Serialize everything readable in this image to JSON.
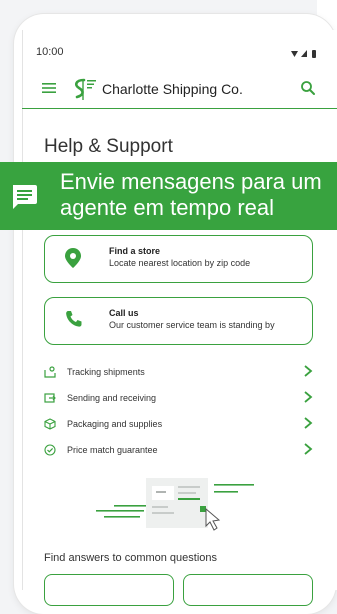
{
  "status_bar": {
    "time": "10:00"
  },
  "app_bar": {
    "brand": "Charlotte Shipping Co."
  },
  "page": {
    "title": "Help & Support"
  },
  "banner": {
    "text": "Envie mensagens para um\nagente em tempo real"
  },
  "cards": [
    {
      "title": "Find a store",
      "description": "Locate nearest location by zip code",
      "icon": "location-pin-icon"
    },
    {
      "title": "Call us",
      "description": "Our customer service team is standing by",
      "icon": "phone-icon"
    }
  ],
  "links": [
    {
      "label": "Tracking shipments",
      "icon": "tracking-icon"
    },
    {
      "label": "Sending and receiving",
      "icon": "send-icon"
    },
    {
      "label": "Packaging and supplies",
      "icon": "package-icon"
    },
    {
      "label": "Price match guarantee",
      "icon": "check-badge-icon"
    }
  ],
  "faq": {
    "heading": "Find answers to common questions"
  },
  "colors": {
    "accent": "#3aa13f",
    "banner": "#38a33f",
    "text": "#333333"
  }
}
